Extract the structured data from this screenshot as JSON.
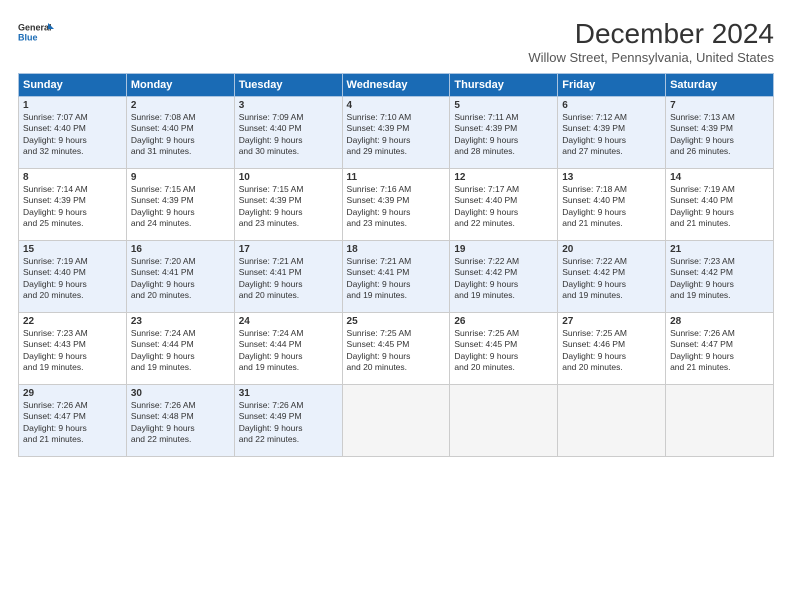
{
  "header": {
    "logo_line1": "General",
    "logo_line2": "Blue",
    "title": "December 2024",
    "location": "Willow Street, Pennsylvania, United States"
  },
  "columns": [
    "Sunday",
    "Monday",
    "Tuesday",
    "Wednesday",
    "Thursday",
    "Friday",
    "Saturday"
  ],
  "weeks": [
    [
      {
        "day": "1",
        "content": "Sunrise: 7:07 AM\nSunset: 4:40 PM\nDaylight: 9 hours\nand 32 minutes."
      },
      {
        "day": "2",
        "content": "Sunrise: 7:08 AM\nSunset: 4:40 PM\nDaylight: 9 hours\nand 31 minutes."
      },
      {
        "day": "3",
        "content": "Sunrise: 7:09 AM\nSunset: 4:40 PM\nDaylight: 9 hours\nand 30 minutes."
      },
      {
        "day": "4",
        "content": "Sunrise: 7:10 AM\nSunset: 4:39 PM\nDaylight: 9 hours\nand 29 minutes."
      },
      {
        "day": "5",
        "content": "Sunrise: 7:11 AM\nSunset: 4:39 PM\nDaylight: 9 hours\nand 28 minutes."
      },
      {
        "day": "6",
        "content": "Sunrise: 7:12 AM\nSunset: 4:39 PM\nDaylight: 9 hours\nand 27 minutes."
      },
      {
        "day": "7",
        "content": "Sunrise: 7:13 AM\nSunset: 4:39 PM\nDaylight: 9 hours\nand 26 minutes."
      }
    ],
    [
      {
        "day": "8",
        "content": "Sunrise: 7:14 AM\nSunset: 4:39 PM\nDaylight: 9 hours\nand 25 minutes."
      },
      {
        "day": "9",
        "content": "Sunrise: 7:15 AM\nSunset: 4:39 PM\nDaylight: 9 hours\nand 24 minutes."
      },
      {
        "day": "10",
        "content": "Sunrise: 7:15 AM\nSunset: 4:39 PM\nDaylight: 9 hours\nand 23 minutes."
      },
      {
        "day": "11",
        "content": "Sunrise: 7:16 AM\nSunset: 4:39 PM\nDaylight: 9 hours\nand 23 minutes."
      },
      {
        "day": "12",
        "content": "Sunrise: 7:17 AM\nSunset: 4:40 PM\nDaylight: 9 hours\nand 22 minutes."
      },
      {
        "day": "13",
        "content": "Sunrise: 7:18 AM\nSunset: 4:40 PM\nDaylight: 9 hours\nand 21 minutes."
      },
      {
        "day": "14",
        "content": "Sunrise: 7:19 AM\nSunset: 4:40 PM\nDaylight: 9 hours\nand 21 minutes."
      }
    ],
    [
      {
        "day": "15",
        "content": "Sunrise: 7:19 AM\nSunset: 4:40 PM\nDaylight: 9 hours\nand 20 minutes."
      },
      {
        "day": "16",
        "content": "Sunrise: 7:20 AM\nSunset: 4:41 PM\nDaylight: 9 hours\nand 20 minutes."
      },
      {
        "day": "17",
        "content": "Sunrise: 7:21 AM\nSunset: 4:41 PM\nDaylight: 9 hours\nand 20 minutes."
      },
      {
        "day": "18",
        "content": "Sunrise: 7:21 AM\nSunset: 4:41 PM\nDaylight: 9 hours\nand 19 minutes."
      },
      {
        "day": "19",
        "content": "Sunrise: 7:22 AM\nSunset: 4:42 PM\nDaylight: 9 hours\nand 19 minutes."
      },
      {
        "day": "20",
        "content": "Sunrise: 7:22 AM\nSunset: 4:42 PM\nDaylight: 9 hours\nand 19 minutes."
      },
      {
        "day": "21",
        "content": "Sunrise: 7:23 AM\nSunset: 4:42 PM\nDaylight: 9 hours\nand 19 minutes."
      }
    ],
    [
      {
        "day": "22",
        "content": "Sunrise: 7:23 AM\nSunset: 4:43 PM\nDaylight: 9 hours\nand 19 minutes."
      },
      {
        "day": "23",
        "content": "Sunrise: 7:24 AM\nSunset: 4:44 PM\nDaylight: 9 hours\nand 19 minutes."
      },
      {
        "day": "24",
        "content": "Sunrise: 7:24 AM\nSunset: 4:44 PM\nDaylight: 9 hours\nand 19 minutes."
      },
      {
        "day": "25",
        "content": "Sunrise: 7:25 AM\nSunset: 4:45 PM\nDaylight: 9 hours\nand 20 minutes."
      },
      {
        "day": "26",
        "content": "Sunrise: 7:25 AM\nSunset: 4:45 PM\nDaylight: 9 hours\nand 20 minutes."
      },
      {
        "day": "27",
        "content": "Sunrise: 7:25 AM\nSunset: 4:46 PM\nDaylight: 9 hours\nand 20 minutes."
      },
      {
        "day": "28",
        "content": "Sunrise: 7:26 AM\nSunset: 4:47 PM\nDaylight: 9 hours\nand 21 minutes."
      }
    ],
    [
      {
        "day": "29",
        "content": "Sunrise: 7:26 AM\nSunset: 4:47 PM\nDaylight: 9 hours\nand 21 minutes."
      },
      {
        "day": "30",
        "content": "Sunrise: 7:26 AM\nSunset: 4:48 PM\nDaylight: 9 hours\nand 22 minutes."
      },
      {
        "day": "31",
        "content": "Sunrise: 7:26 AM\nSunset: 4:49 PM\nDaylight: 9 hours\nand 22 minutes."
      },
      {
        "day": "",
        "content": ""
      },
      {
        "day": "",
        "content": ""
      },
      {
        "day": "",
        "content": ""
      },
      {
        "day": "",
        "content": ""
      }
    ]
  ]
}
